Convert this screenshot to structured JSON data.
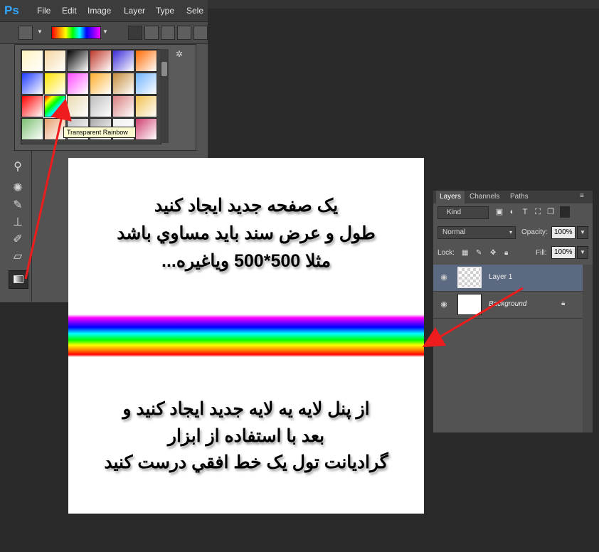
{
  "app": {
    "logo": "Ps",
    "menu": [
      "File",
      "Edit",
      "Image",
      "Layer",
      "Type",
      "Sele"
    ]
  },
  "picker": {
    "tooltip": "Transparent Rainbow",
    "swatches": [
      [
        "#fff3c0",
        "#f5d7a0",
        "#000000",
        "#c0392b",
        "#3a2bd8",
        "#ff6a00"
      ],
      [
        "#1e3cff",
        "#ffe400",
        "#ff4bff",
        "#ffae2c",
        "#c58c3c",
        "#6fb4ff"
      ],
      [
        "#ff0000",
        "#f0e68c",
        "#e8d9b0",
        "#bdbdbd",
        "#d98080",
        "#f0c050"
      ],
      [
        "#7ac070",
        "#e8a070",
        "#c0c0c0",
        "#a8a8a8",
        "#f0f0f0",
        "#d04070"
      ]
    ]
  },
  "document": {
    "lines_top": [
      "یک صفحه جدید ایجاد کنید",
      "طول و عرض سند باید مساوي باشد",
      "مثلا 500*500 وياغيره..."
    ],
    "lines_bottom": [
      "از  پنل لایه یه لایه جدید ایجاد کنید و",
      "بعد با  استفاده از ابزار",
      "گرادیانت تول یک خط افقي درست کنيد"
    ]
  },
  "layers": {
    "tabs": [
      "Layers",
      "Channels",
      "Paths"
    ],
    "kind": "Kind",
    "blend_mode": "Normal",
    "opacity_label": "Opacity:",
    "opacity": "100%",
    "lock_label": "Lock:",
    "fill_label": "Fill:",
    "fill": "100%",
    "items": [
      {
        "name": "Layer 1",
        "selected": true
      },
      {
        "name": "Background",
        "selected": false
      }
    ]
  },
  "colors": {
    "selected_layer": "#5b6a80",
    "arrow": "#ee1c1c"
  }
}
